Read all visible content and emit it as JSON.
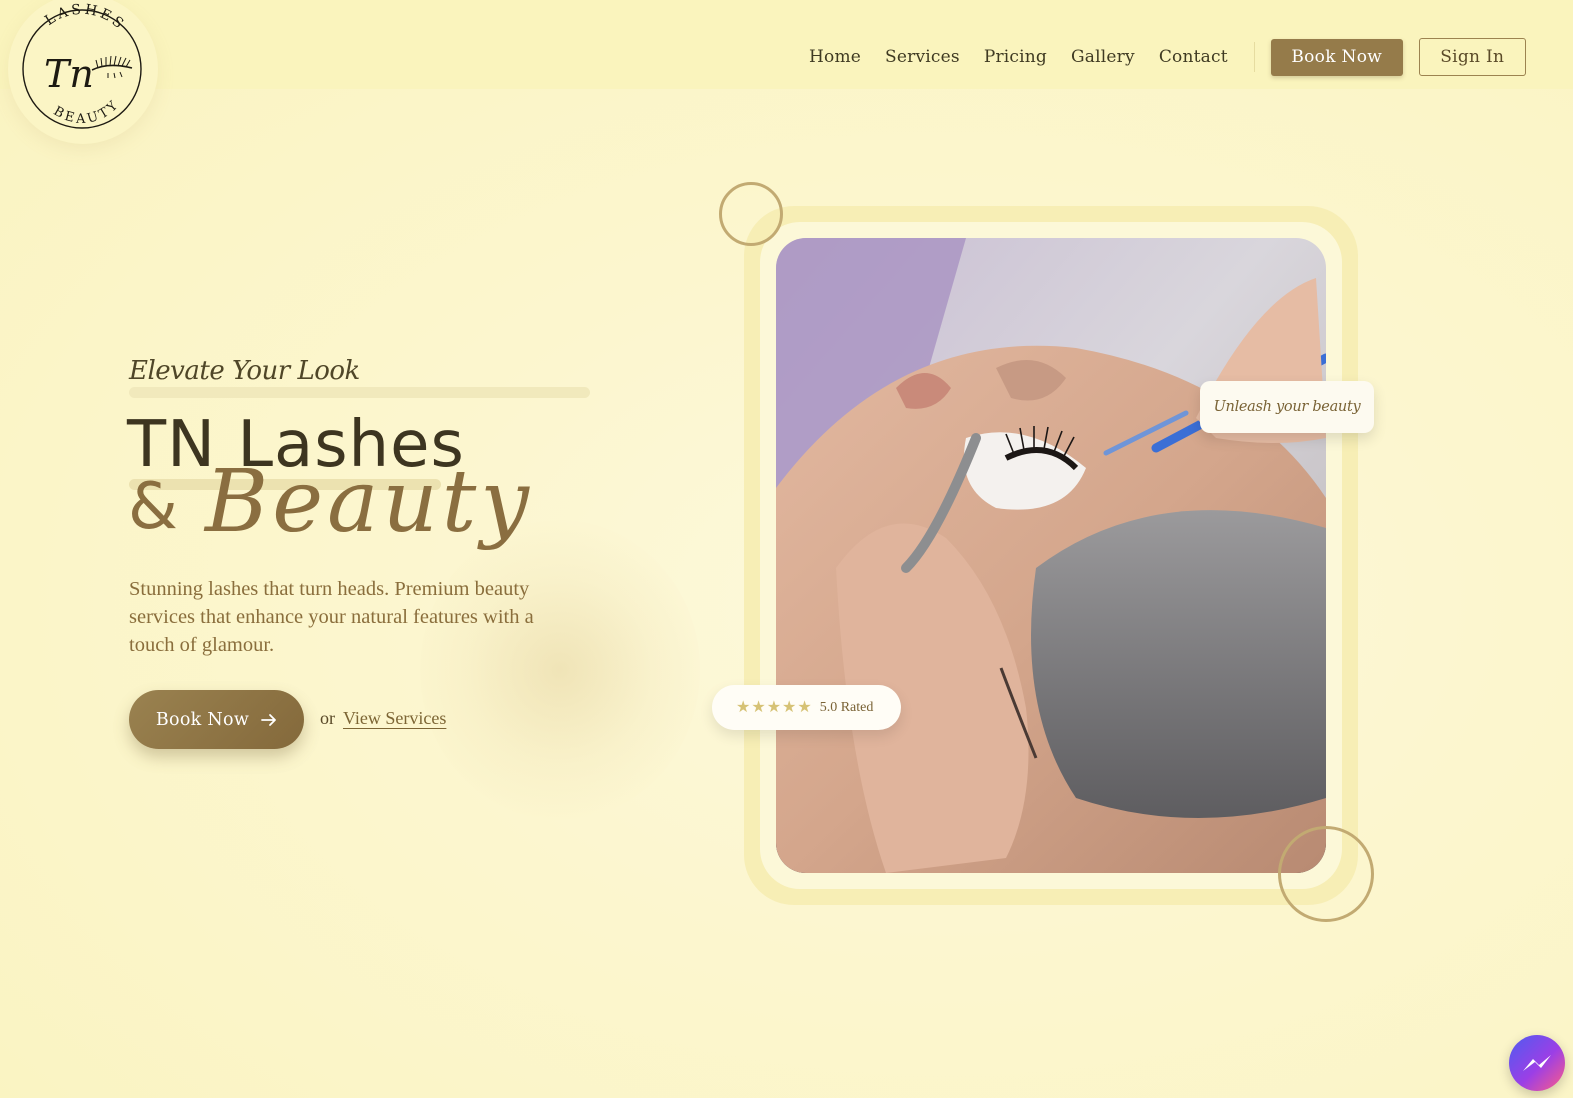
{
  "brand": {
    "logo_top": "LASHES",
    "logo_monogram": "Tn",
    "logo_bottom": "BEAUTY"
  },
  "nav": {
    "items": [
      "Home",
      "Services",
      "Pricing",
      "Gallery",
      "Contact"
    ],
    "book_label": "Book Now",
    "signin_label": "Sign In"
  },
  "hero": {
    "eyebrow": "Elevate Your Look",
    "title_line1": "TN Lashes",
    "title_amp": "&",
    "title_script": "Beauty",
    "description": "Stunning lashes that turn heads. Premium beauty services that enhance your natural features with a touch of glamour.",
    "cta_label": "Book Now",
    "cta_icon": "arrow-right-icon",
    "or_text": "or",
    "secondary_link": "View Services"
  },
  "image_card": {
    "badge_text": "Unleash your beauty",
    "rating_text": "5.0 Rated",
    "rating_stars": 5,
    "image_subject": "eyelash extension application"
  },
  "colors": {
    "background": "#fbf5c8",
    "accent": "#957b4a",
    "text_dark": "#3d3520",
    "frame": "#f7eeb5"
  },
  "widgets": {
    "chat_icon": "messenger-icon"
  }
}
